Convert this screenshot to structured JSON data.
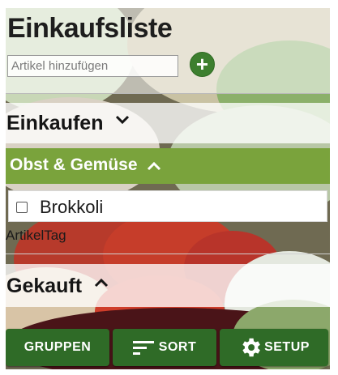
{
  "header": {
    "title": "Einkaufsliste",
    "add_placeholder": "Artikel hinzufügen",
    "add_button_icon": "plus-icon"
  },
  "sections": {
    "shopping": {
      "title": "Einkaufen",
      "chevron": "chevron-down-icon"
    },
    "bought": {
      "title": "Gekauft",
      "chevron": "chevron-up-icon"
    }
  },
  "group": {
    "label": "Obst & Gemüse",
    "chevron": "chevron-up-icon"
  },
  "items": [
    {
      "label": "Brokkoli",
      "checked": false
    }
  ],
  "artikel_tag": "ArtikelTag",
  "toolbar": {
    "groups_label": "GRUPPEN",
    "sort_label": "SORT",
    "setup_label": "SETUP"
  },
  "colors": {
    "accent_green": "#2f6b27",
    "group_green": "#7aa33c",
    "add_green": "#3d7f2f"
  }
}
